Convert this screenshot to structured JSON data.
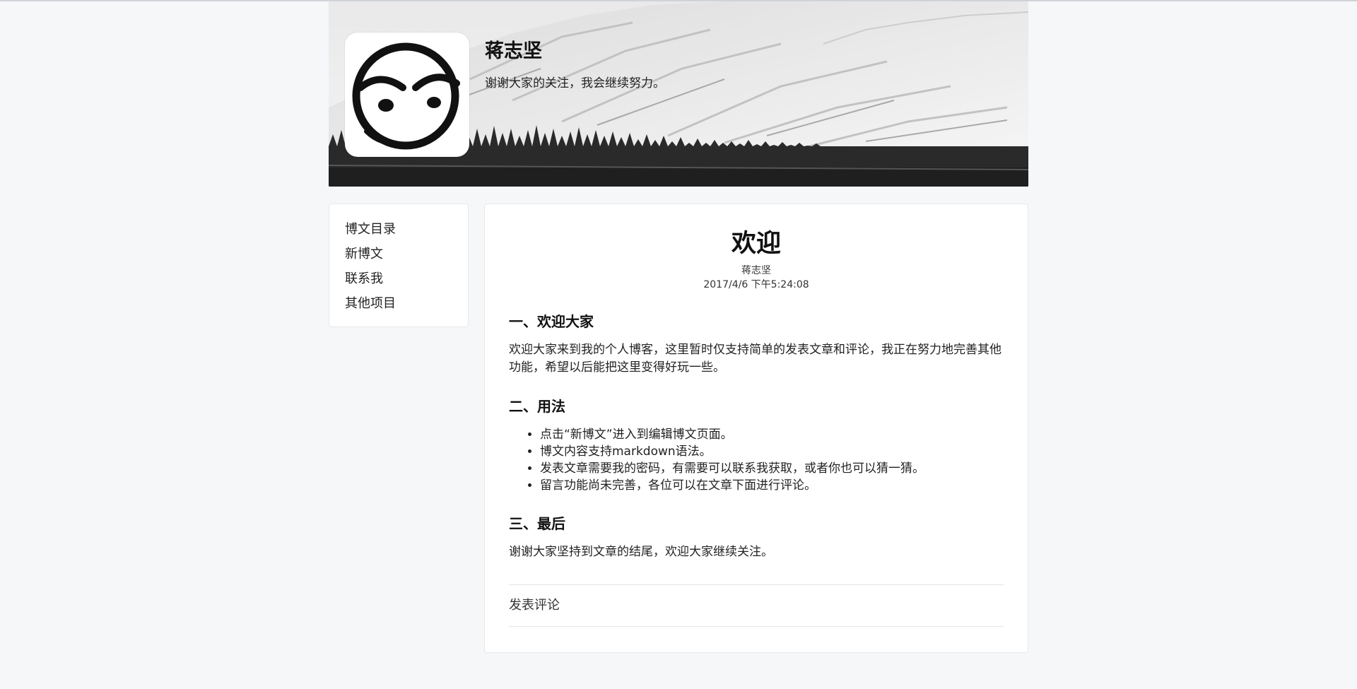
{
  "site": {
    "title": "蒋志坚",
    "description": "谢谢大家的关注，我会继续努力。"
  },
  "sidebar": {
    "items": [
      {
        "label": "博文目录"
      },
      {
        "label": "新博文"
      },
      {
        "label": "联系我"
      },
      {
        "label": "其他项目"
      }
    ]
  },
  "article": {
    "title": "欢迎",
    "author": "蒋志坚",
    "date": "2017/4/6 下午5:24:08",
    "sections": [
      {
        "heading": "一、欢迎大家",
        "paragraph": "欢迎大家来到我的个人博客，这里暂时仅支持简单的发表文章和评论，我正在努力地完善其他功能，希望以后能把这里变得好玩一些。"
      },
      {
        "heading": "二、用法",
        "list": [
          "点击“新博文”进入到编辑博文页面。",
          "博文内容支持markdown语法。",
          "发表文章需要我的密码，有需要可以联系我获取，或者你也可以猜一猜。",
          "留言功能尚未完善，各位可以在文章下面进行评论。"
        ]
      },
      {
        "heading": "三、最后",
        "paragraph": "谢谢大家坚持到文章的结尾，欢迎大家继续关注。"
      }
    ]
  },
  "comments": {
    "post_label": "发表评论"
  },
  "colors": {
    "page_background": "#f6f7f9",
    "card_background": "#ffffff",
    "border": "#e6e8eb"
  },
  "icons": {
    "avatar": "ink-circle-face-icon"
  }
}
